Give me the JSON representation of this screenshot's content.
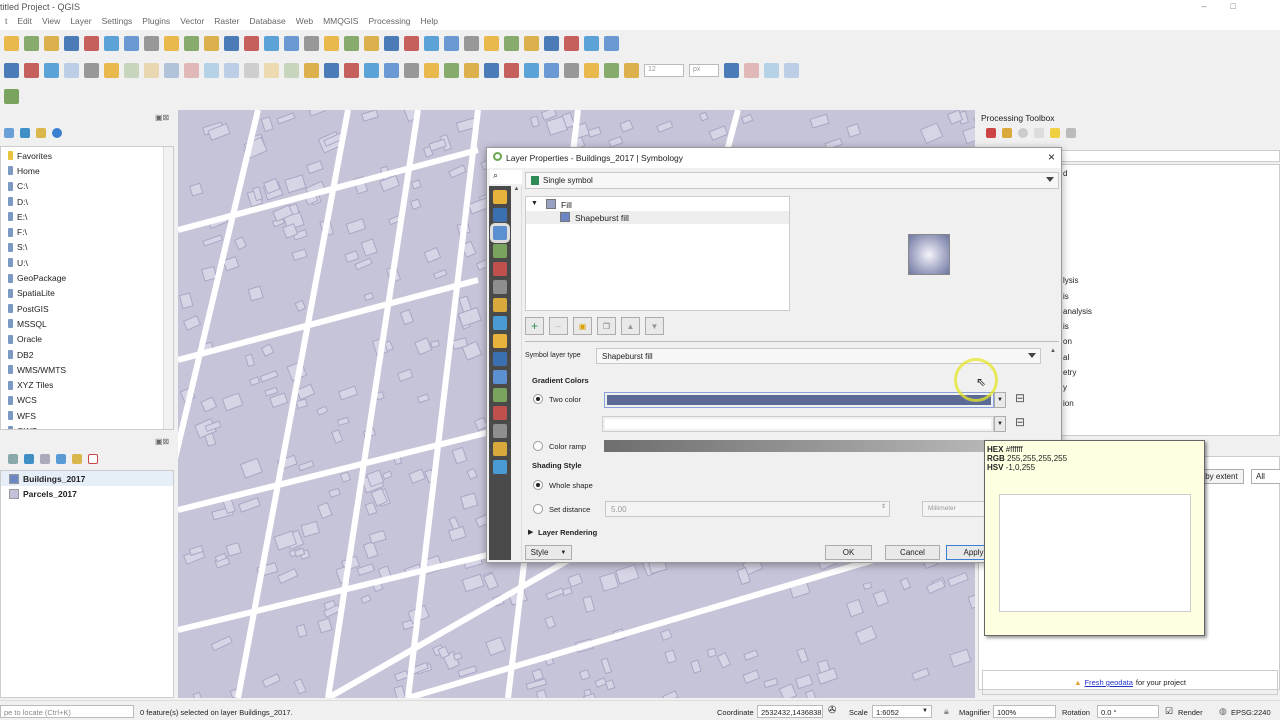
{
  "window": {
    "title": "titled Project - QGIS"
  },
  "menu": [
    "t",
    "Edit",
    "View",
    "Layer",
    "Settings",
    "Plugins",
    "Vector",
    "Raster",
    "Database",
    "Web",
    "MMQGIS",
    "Processing",
    "Help"
  ],
  "toolbar1": [
    "open-project-icon",
    "save-project-icon",
    "save-as-icon",
    "new-print-layout-icon",
    "layout-manager-icon",
    "style-manager-icon",
    "pan-icon",
    "pan-to-selection-icon",
    "zoom-in-icon",
    "zoom-out-icon",
    "zoom-native-icon",
    "zoom-full-icon",
    "zoom-to-selection-icon",
    "zoom-to-layer-icon",
    "zoom-last-icon",
    "zoom-next-icon",
    "new-bookmark-icon",
    "show-bookmarks-icon",
    "spatial-bookmarks-icon",
    "refresh-icon",
    "identify-icon",
    "measure-icon",
    "select-features-icon",
    "select-by-value-icon",
    "deselect-icon",
    "attribute-table-icon",
    "toolbox-icon",
    "statistics-icon",
    "measure-line-icon",
    "annotation-icon",
    "text-annotation-icon"
  ],
  "toolbar2": [
    "data-source-manager-icon",
    "digitize-icon",
    "edit-pencil-icon",
    "save-edits-icon",
    "current-edits-icon",
    "toggle-editing-icon",
    "add-feature-icon",
    "vertex-tool-icon",
    "modify-attributes-icon",
    "delete-selected-icon",
    "cut-icon",
    "copy-icon",
    "paste-icon",
    "undo-icon",
    "redo-icon",
    "label-icon",
    "diagram-icon",
    "layer-labeling-icon",
    "pin-labels-icon",
    "show-labels-icon",
    "move-label-icon",
    "rotate-label-icon",
    "change-label-icon",
    "georeferencer-icon",
    "wms-icon",
    "globe-icon",
    "python-icon",
    "plugin-icon",
    "help-icon",
    "magnet-icon",
    "snapping-icon",
    "tolerance-icon",
    "unit-icon",
    "trace-icon",
    "split-icon",
    "reshape-icon"
  ],
  "snap": {
    "tolerance": "12",
    "unit": "px"
  },
  "browser": {
    "items": [
      "Favorites",
      "Home",
      "C:\\",
      "D:\\",
      "E:\\",
      "F:\\",
      "S:\\",
      "U:\\",
      "GeoPackage",
      "SpatiaLite",
      "PostGIS",
      "MSSQL",
      "Oracle",
      "DB2",
      "WMS/WMTS",
      "XYZ Tiles",
      "WCS",
      "WFS",
      "OWS"
    ]
  },
  "layers": {
    "items": [
      {
        "name": "Buildings_2017",
        "color": "#6d86c4"
      },
      {
        "name": "Parcels_2017",
        "color": "#c4c2da"
      }
    ]
  },
  "processing": {
    "title": "Processing Toolbox",
    "items": [
      "d",
      "lysis",
      "is",
      "analysis",
      "is",
      "on",
      "al",
      "etry",
      "y",
      "ion"
    ],
    "filter_label": "r by extent",
    "filter_value": "All",
    "footer_link": "Fresh geodata",
    "footer_text": "for your project"
  },
  "dialog": {
    "title": "Layer Properties - Buildings_2017 | Symbology",
    "renderer": "Single symbol",
    "tree": {
      "root": "Fill",
      "child": "Shapeburst fill"
    },
    "symbol_layer_type_label": "Symbol layer type",
    "symbol_layer_type": "Shapeburst fill",
    "gradient_colors": "Gradient Colors",
    "two_color": "Two color",
    "color1": "#5b6b96",
    "color2": "#ffffff",
    "color_ramp": "Color ramp",
    "shading_style": "Shading Style",
    "whole_shape": "Whole shape",
    "set_distance": "Set distance",
    "distance_value": "5.00",
    "distance_unit": "Millimeter",
    "layer_rendering": "Layer Rendering",
    "style": "Style",
    "ok": "OK",
    "cancel": "Cancel",
    "apply": "Apply"
  },
  "tooltip": {
    "hex_label": "HEX",
    "hex": "#ffffff",
    "rgb_label": "RGB",
    "rgb": "255,255,255,255",
    "hsv_label": "HSV",
    "hsv": "-1,0,255"
  },
  "status": {
    "locate_placeholder": "pe to locate (Ctrl+K)",
    "message": "0 feature(s) selected on layer Buildings_2017.",
    "coordinate_label": "Coordinate",
    "coordinate": "2532432,1436838",
    "scale_label": "Scale",
    "scale": "1:6052",
    "magnifier_label": "Magnifier",
    "magnifier": "100%",
    "rotation_label": "Rotation",
    "rotation": "0.0 °",
    "render_label": "Render",
    "crs": "EPSG:2240"
  }
}
